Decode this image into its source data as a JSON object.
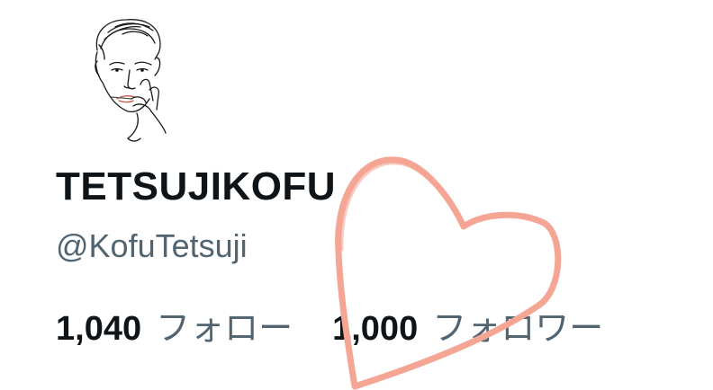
{
  "profile": {
    "display_name": "TETSUJIKOFU",
    "handle": "@KofuTetsuji",
    "avatar_icon": "line-drawing-portrait-icon"
  },
  "stats": [
    {
      "count": "1,040",
      "label": "フォロー"
    },
    {
      "count": "1,000",
      "label": "フォロワー"
    }
  ],
  "overlay": {
    "icon": "hand-drawn-heart-icon",
    "color": "#f4a593"
  },
  "colors": {
    "primary_text": "#0f1419",
    "secondary_text": "#536471"
  }
}
